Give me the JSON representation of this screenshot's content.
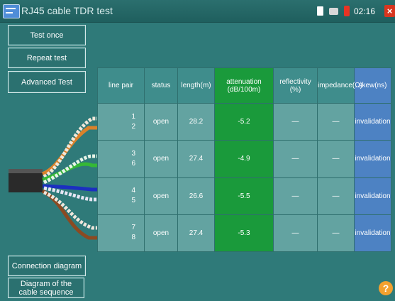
{
  "window": {
    "title": "RJ45 cable TDR test",
    "clock": "02:16"
  },
  "buttons": {
    "test_once": "Test once",
    "repeat_test": "Repeat test",
    "advanced_test": "Advanced Test",
    "connection_diagram": "Connection diagram",
    "cable_sequence": "Diagram of the cable sequence"
  },
  "table": {
    "headers": [
      "line pair",
      "status",
      "length(m)",
      "attenuation (dB/100m)",
      "reflectivity (%)",
      "impedance(Ω)",
      "skew(ns)"
    ],
    "rows": [
      {
        "pair_a": "1",
        "pair_b": "2",
        "status": "open",
        "length": "28.2",
        "attenuation": "-5.2",
        "reflectivity": "—",
        "impedance": "—",
        "skew": "invalidation"
      },
      {
        "pair_a": "3",
        "pair_b": "6",
        "status": "open",
        "length": "27.4",
        "attenuation": "-4.9",
        "reflectivity": "—",
        "impedance": "—",
        "skew": "invalidation"
      },
      {
        "pair_a": "4",
        "pair_b": "5",
        "status": "open",
        "length": "26.6",
        "attenuation": "-5.5",
        "reflectivity": "—",
        "impedance": "—",
        "skew": "invalidation"
      },
      {
        "pair_a": "7",
        "pair_b": "8",
        "status": "open",
        "length": "27.4",
        "attenuation": "-5.3",
        "reflectivity": "—",
        "impedance": "—",
        "skew": "invalidation"
      }
    ]
  },
  "icons": {
    "app": "app-icon",
    "sd_card": "sd-card-icon",
    "screenshot": "image-icon",
    "battery": "battery-icon",
    "close": "close-icon",
    "help": "help-icon"
  },
  "colors": {
    "background": "#2f7a79",
    "attenuation_column": "#1a9a3b",
    "skew_column": "#4d82c3",
    "pair_orange": "#d9822b",
    "pair_green": "#35b836",
    "pair_blue": "#1b2fc0",
    "pair_brown": "#8b4a22"
  }
}
